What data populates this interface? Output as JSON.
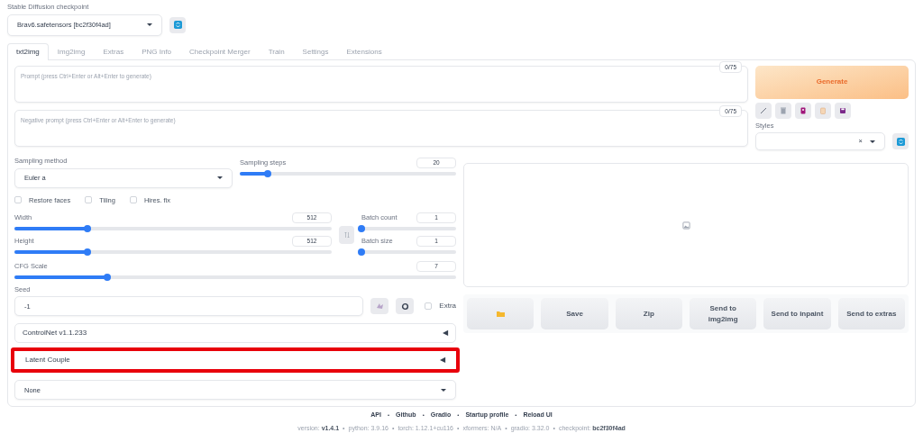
{
  "checkpoint": {
    "label": "Stable Diffusion checkpoint",
    "value": "Brav6.safetensors [bc2f30f4ad]"
  },
  "tabs": [
    {
      "label": "txt2img",
      "selected": true
    },
    {
      "label": "Img2img",
      "selected": false
    },
    {
      "label": "Extras",
      "selected": false
    },
    {
      "label": "PNG Info",
      "selected": false
    },
    {
      "label": "Checkpoint Merger",
      "selected": false
    },
    {
      "label": "Train",
      "selected": false
    },
    {
      "label": "Settings",
      "selected": false
    },
    {
      "label": "Extensions",
      "selected": false
    }
  ],
  "prompt": {
    "placeholder": "Prompt (press Ctrl+Enter or Alt+Enter to generate)",
    "counter": "0/75"
  },
  "negative_prompt": {
    "placeholder": "Negative prompt (press Ctrl+Enter or Alt+Enter to generate)",
    "counter": "0/75"
  },
  "generate_button": "Generate",
  "styles": {
    "label": "Styles",
    "clear": "×"
  },
  "sampling_method": {
    "label": "Sampling method",
    "value": "Euler a"
  },
  "sampling_steps": {
    "label": "Sampling steps",
    "value": "20",
    "level": 0.13
  },
  "checkboxes": [
    {
      "label": "Restore faces",
      "checked": false
    },
    {
      "label": "Tiling",
      "checked": false
    },
    {
      "label": "Hires. fix",
      "checked": false
    }
  ],
  "width": {
    "label": "Width",
    "value": "512",
    "level": 0.23
  },
  "height": {
    "label": "Height",
    "value": "512",
    "level": 0.23
  },
  "batch_count": {
    "label": "Batch count",
    "value": "1",
    "level": 0
  },
  "batch_size": {
    "label": "Batch size",
    "value": "1",
    "level": 0
  },
  "cfg_scale": {
    "label": "CFG Scale",
    "value": "7",
    "level": 0.21
  },
  "seed": {
    "label": "Seed",
    "value": "-1"
  },
  "extra": {
    "label": "Extra",
    "checked": false
  },
  "accordions": [
    {
      "label": "ControlNet v1.1.233",
      "toggle": "◀",
      "highlighted": false
    },
    {
      "label": "Latent Couple",
      "toggle": "◀",
      "highlighted": true
    }
  ],
  "script": {
    "value": "None"
  },
  "output_buttons": [
    {
      "kind": "folder"
    },
    {
      "kind": "text",
      "label": "Save"
    },
    {
      "kind": "text",
      "label": "Zip"
    },
    {
      "kind": "text",
      "label": "Send to img2img"
    },
    {
      "kind": "text",
      "label": "Send to inpaint"
    },
    {
      "kind": "text",
      "label": "Send to extras"
    }
  ],
  "footer": {
    "links": [
      "API",
      "Github",
      "Gradio",
      "Startup profile",
      "Reload UI"
    ],
    "separator": "•",
    "versions": [
      "version: **v1.4.1**",
      "python: 3.9.16",
      "torch: 1.12.1+cu116",
      "xformers: N/A",
      "gradio: 3.32.0",
      "checkpoint: **bc2f30f4ad**"
    ]
  }
}
